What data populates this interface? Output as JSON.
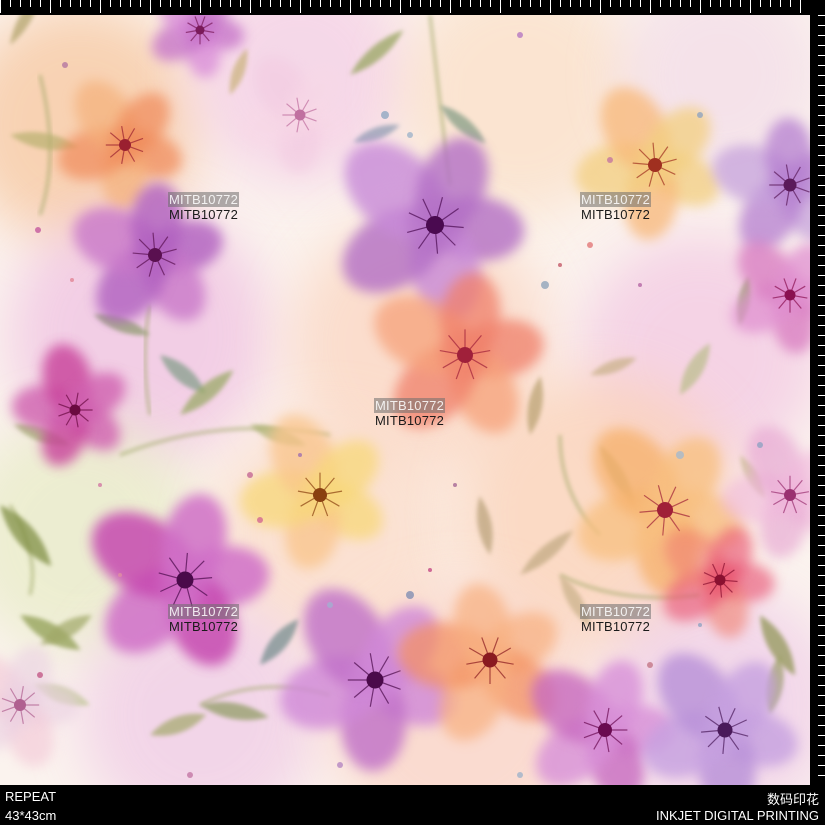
{
  "watermark_code": "MITB10772",
  "footer": {
    "repeat": "REPEAT",
    "size": "43*43cm",
    "print_cn": "数码印花",
    "print_en": "INKJET DIGITAL PRINTING"
  },
  "colors": {
    "frame": "#000000",
    "background": "#fbf3ee",
    "magenta": "#c04aa6",
    "violet": "#b890d8",
    "peach": "#f6a27a",
    "yellow": "#f8d87a",
    "leaf": "#8f9a55"
  }
}
